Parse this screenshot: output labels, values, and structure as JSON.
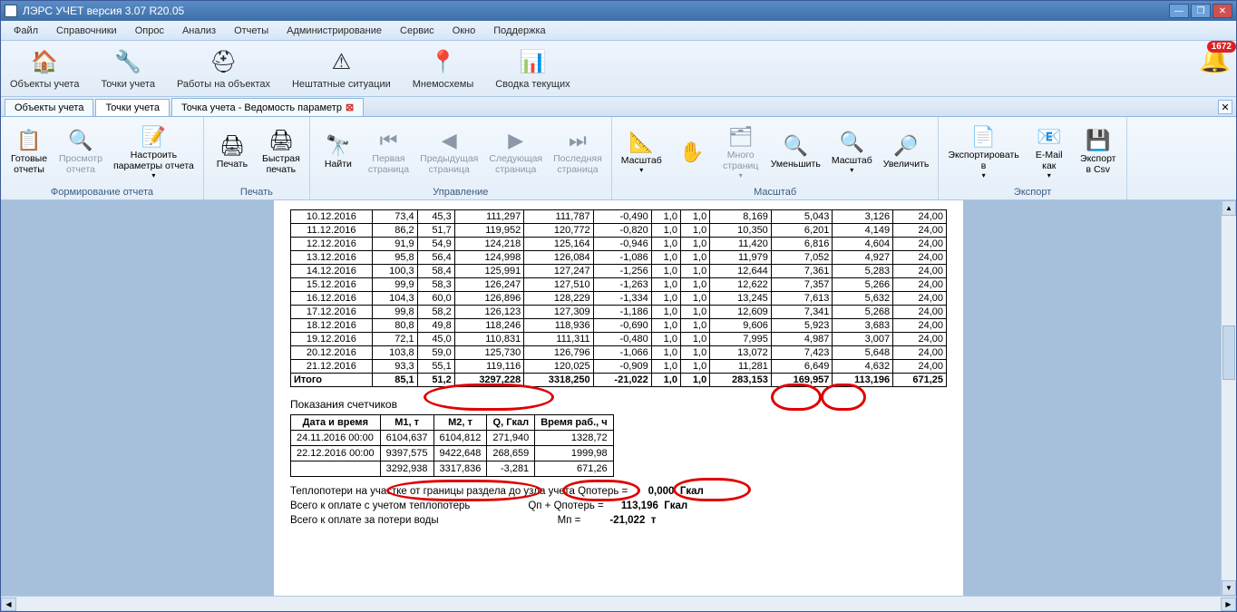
{
  "window": {
    "title": "ЛЭРС УЧЕТ версия 3.07 R20.05"
  },
  "notifications": {
    "count": "1672"
  },
  "menu": [
    "Файл",
    "Справочники",
    "Опрос",
    "Анализ",
    "Отчеты",
    "Администрирование",
    "Сервис",
    "Окно",
    "Поддержка"
  ],
  "maintoolbar": [
    {
      "icon": "🏠",
      "label": "Объекты учета",
      "name": "объекты-учета"
    },
    {
      "icon": "🔧",
      "label": "Точки учета",
      "name": "точки-учета"
    },
    {
      "icon": "⛑",
      "label": "Работы на объектах",
      "name": "работы-на-объектах"
    },
    {
      "icon": "⚠",
      "label": "Нештатные ситуации",
      "name": "нештатные-ситуации"
    },
    {
      "icon": "📍",
      "label": "Мнемосхемы",
      "name": "мнемосхемы"
    },
    {
      "icon": "📊",
      "label": "Сводка текущих",
      "name": "сводка-текущих"
    }
  ],
  "tabs": [
    {
      "label": "Объекты учета",
      "active": false
    },
    {
      "label": "Точки учета",
      "active": true
    },
    {
      "label": "Точка учета - Ведомость параметр",
      "active": false,
      "closable": true
    }
  ],
  "ribbon": {
    "groups": [
      {
        "title": "Формирование отчета",
        "buttons": [
          {
            "icon": "📋",
            "label": "Готовые\nотчеты",
            "name": "готовые-отчеты"
          },
          {
            "icon": "🔍",
            "label": "Просмотр\nотчета",
            "name": "просмотр-отчета",
            "disabled": true
          },
          {
            "icon": "📝",
            "label": "Настроить\nпараметры отчета",
            "name": "настроить-параметры",
            "dd": true
          }
        ]
      },
      {
        "title": "Печать",
        "buttons": [
          {
            "icon": "🖨",
            "label": "Печать",
            "name": "печать"
          },
          {
            "icon": "🖨",
            "label": "Быстрая\nпечать",
            "name": "быстрая-печать"
          }
        ]
      },
      {
        "title": "Управление",
        "buttons": [
          {
            "icon": "🔭",
            "label": "Найти",
            "name": "найти"
          },
          {
            "icon": "⏮",
            "label": "Первая\nстраница",
            "name": "первая-страница",
            "disabled": true
          },
          {
            "icon": "◀",
            "label": "Предыдущая\nстраница",
            "name": "предыдущая-страница",
            "disabled": true
          },
          {
            "icon": "▶",
            "label": "Следующая\nстраница",
            "name": "следующая-страница",
            "disabled": true
          },
          {
            "icon": "⏭",
            "label": "Последняя\nстраница",
            "name": "последняя-страница",
            "disabled": true
          }
        ]
      },
      {
        "title": "Масштаб",
        "buttons": [
          {
            "icon": "📐",
            "label": "Масштаб",
            "name": "масштаб",
            "dd": true
          },
          {
            "icon": "✋",
            "sub": "🔍",
            "label": "",
            "name": "инструмент"
          },
          {
            "icon": "🗂",
            "label": "Много\nстраниц",
            "name": "много-страниц",
            "disabled": true,
            "dd": true
          },
          {
            "icon": "🔍",
            "label": "Уменьшить",
            "name": "уменьшить"
          },
          {
            "icon": "🔍",
            "label": "Масштаб",
            "name": "масштаб-100",
            "dd": true
          },
          {
            "icon": "🔎",
            "label": "Увеличить",
            "name": "увеличить"
          }
        ]
      },
      {
        "title": "Экспорт",
        "buttons": [
          {
            "icon": "📄",
            "label": "Экспортировать\nв",
            "name": "экспортировать-в",
            "dd": true
          },
          {
            "icon": "📧",
            "label": "E-Mail\nкак",
            "name": "email-как",
            "dd": true
          },
          {
            "icon": "💾",
            "label": "Экспорт\nв Csv",
            "name": "экспорт-csv"
          }
        ]
      }
    ]
  },
  "table1_rows": [
    [
      "10.12.2016",
      "73,4",
      "45,3",
      "111,297",
      "111,787",
      "-0,490",
      "1,0",
      "1,0",
      "8,169",
      "5,043",
      "3,126",
      "24,00"
    ],
    [
      "11.12.2016",
      "86,2",
      "51,7",
      "119,952",
      "120,772",
      "-0,820",
      "1,0",
      "1,0",
      "10,350",
      "6,201",
      "4,149",
      "24,00"
    ],
    [
      "12.12.2016",
      "91,9",
      "54,9",
      "124,218",
      "125,164",
      "-0,946",
      "1,0",
      "1,0",
      "11,420",
      "6,816",
      "4,604",
      "24,00"
    ],
    [
      "13.12.2016",
      "95,8",
      "56,4",
      "124,998",
      "126,084",
      "-1,086",
      "1,0",
      "1,0",
      "11,979",
      "7,052",
      "4,927",
      "24,00"
    ],
    [
      "14.12.2016",
      "100,3",
      "58,4",
      "125,991",
      "127,247",
      "-1,256",
      "1,0",
      "1,0",
      "12,644",
      "7,361",
      "5,283",
      "24,00"
    ],
    [
      "15.12.2016",
      "99,9",
      "58,3",
      "126,247",
      "127,510",
      "-1,263",
      "1,0",
      "1,0",
      "12,622",
      "7,357",
      "5,266",
      "24,00"
    ],
    [
      "16.12.2016",
      "104,3",
      "60,0",
      "126,896",
      "128,229",
      "-1,334",
      "1,0",
      "1,0",
      "13,245",
      "7,613",
      "5,632",
      "24,00"
    ],
    [
      "17.12.2016",
      "99,8",
      "58,2",
      "126,123",
      "127,309",
      "-1,186",
      "1,0",
      "1,0",
      "12,609",
      "7,341",
      "5,268",
      "24,00"
    ],
    [
      "18.12.2016",
      "80,8",
      "49,8",
      "118,246",
      "118,936",
      "-0,690",
      "1,0",
      "1,0",
      "9,606",
      "5,923",
      "3,683",
      "24,00"
    ],
    [
      "19.12.2016",
      "72,1",
      "45,0",
      "110,831",
      "111,311",
      "-0,480",
      "1,0",
      "1,0",
      "7,995",
      "4,987",
      "3,007",
      "24,00"
    ],
    [
      "20.12.2016",
      "103,8",
      "59,0",
      "125,730",
      "126,796",
      "-1,066",
      "1,0",
      "1,0",
      "13,072",
      "7,423",
      "5,648",
      "24,00"
    ],
    [
      "21.12.2016",
      "93,3",
      "55,1",
      "119,116",
      "120,025",
      "-0,909",
      "1,0",
      "1,0",
      "11,281",
      "6,649",
      "4,632",
      "24,00"
    ]
  ],
  "table1_total": [
    "Итого",
    "85,1",
    "51,2",
    "3297,228",
    "3318,250",
    "-21,022",
    "1,0",
    "1,0",
    "283,153",
    "169,957",
    "113,196",
    "671,25"
  ],
  "meters_heading": "Показания счетчиков",
  "meters_headers": [
    "Дата и время",
    "M1, т",
    "M2, т",
    "Q, Гкал",
    "Время раб., ч"
  ],
  "meters_rows": [
    [
      "24.11.2016  00:00",
      "6104,637",
      "6104,812",
      "271,940",
      "1328,72"
    ],
    [
      "22.12.2016  00:00",
      "9397,575",
      "9422,648",
      "268,659",
      "1999,98"
    ],
    [
      "",
      "3292,938",
      "3317,836",
      "-3,281",
      "671,26"
    ]
  ],
  "summary": {
    "l1a": "Теплопотери на участке от границы раздела до узла учета Qпотерь =",
    "l1b": "0,000",
    "l1u": "Гкал",
    "l2a": "Всего к оплате с учетом теплопотерь",
    "l2m": "Qп + Qпотерь  =",
    "l2b": "113,196",
    "l2u": "Гкал",
    "l3a": "Всего к оплате за потери воды",
    "l3m": "Mп =",
    "l3b": "-21,022",
    "l3u": "т"
  }
}
